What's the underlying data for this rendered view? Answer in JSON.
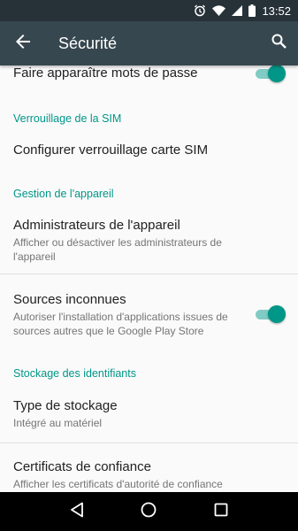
{
  "status_bar": {
    "time": "13:52",
    "icons": [
      "alarm-icon",
      "wifi-icon",
      "signal-icon",
      "battery-icon"
    ]
  },
  "app_bar": {
    "title": "Sécurité",
    "back_icon": "arrow-back-icon",
    "search_icon": "search-icon"
  },
  "settings": {
    "show_passwords": {
      "label": "Faire apparaître mots de passe",
      "enabled": true
    },
    "sim_lock_header": "Verrouillage de la SIM",
    "sim_lock": {
      "label": "Configurer verrouillage carte SIM"
    },
    "device_admin_header": "Gestion de l'appareil",
    "device_admins": {
      "label": "Administrateurs de l'appareil",
      "summary": "Afficher ou désactiver les administrateurs de l'appareil"
    },
    "unknown_sources": {
      "label": "Sources inconnues",
      "summary": "Autoriser l'installation d'applications issues de sources autres que le Google Play Store",
      "enabled": true
    },
    "credential_storage_header": "Stockage des identifiants",
    "storage_type": {
      "label": "Type de stockage",
      "summary": "Intégré au matériel"
    },
    "trusted_credentials": {
      "label": "Certificats de confiance",
      "summary": "Afficher les certificats d'autorité de confiance"
    }
  },
  "colors": {
    "accent": "#009688",
    "toolbar": "#37474f",
    "status_bar": "#263238"
  },
  "nav_bar": {
    "icons": [
      "back-triangle-icon",
      "home-circle-icon",
      "recents-square-icon"
    ]
  }
}
